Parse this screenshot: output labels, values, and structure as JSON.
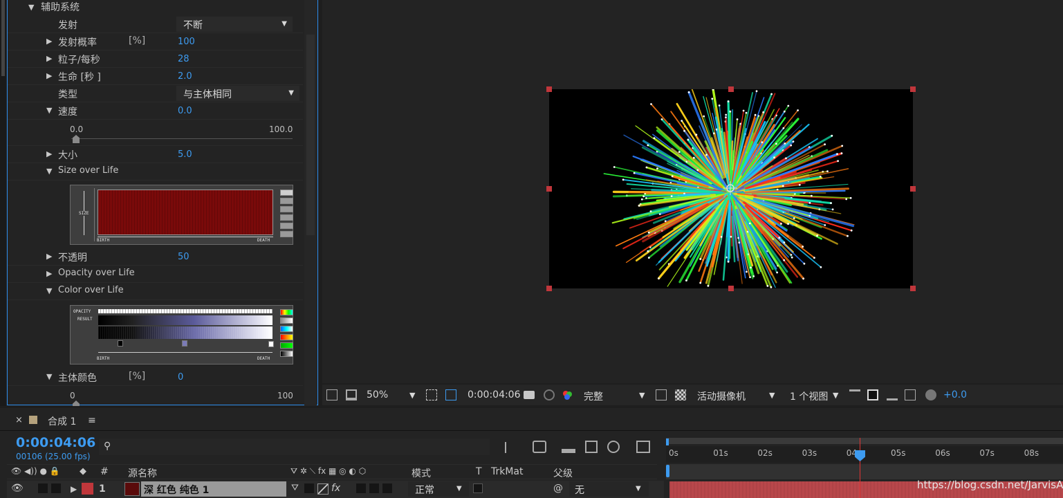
{
  "effects": {
    "section": "辅助系统",
    "rows": {
      "emit_label": "发射",
      "emit_value": "不断",
      "prob_label": "发射概率",
      "prob_unit": "[%]",
      "prob_value": "100",
      "pps_label": "粒子/每秒",
      "pps_value": "28",
      "life_label": "生命 [秒 ]",
      "life_value": "2.0",
      "type_label": "类型",
      "type_value": "与主体相同",
      "speed_label": "速度",
      "speed_value": "0.0",
      "speed_min": "0.0",
      "speed_max": "100.0",
      "size_label": "大小",
      "size_value": "5.0",
      "sol_label": "Size over Life",
      "opacity_label": "不透明",
      "opacity_value": "50",
      "ool_label": "Opacity over Life",
      "col_label": "Color over Life",
      "main_color_label": "主体颜色",
      "main_color_unit": "[%]",
      "main_color_value": "0",
      "main_color_min": "0",
      "main_color_max": "100"
    },
    "size_graph": {
      "axis": "SIZE",
      "start": "BIRTH",
      "end": "DEATH",
      "fill_color": "#7a0a0a"
    },
    "color_graph": {
      "opacity": "OPACITY",
      "result": "RESULT",
      "start": "BIRTH",
      "end": "DEATH"
    }
  },
  "viewer_toolbar": {
    "zoom": "50%",
    "timecode": "0:00:04:06",
    "resolution": "完整",
    "camera": "活动摄像机",
    "views": "1 个视图",
    "exposure": "+0.0"
  },
  "timeline": {
    "comp_tab": "合成 1",
    "current_time": "0:00:04:06",
    "frame_info": "00106 (25.00 fps)",
    "columns": {
      "num": "#",
      "source": "源名称",
      "mode": "模式",
      "t": "T",
      "trkmat": "TrkMat",
      "parent": "父级"
    },
    "layer": {
      "index": "1",
      "name": "深 红色 纯色 1",
      "mode": "正常",
      "parent": "无",
      "label_color": "#c0373b",
      "swatch_color": "#5a0b0b"
    },
    "ruler": [
      "0s",
      "01s",
      "02s",
      "03s",
      "04s",
      "05s",
      "06s",
      "07s",
      "08s"
    ],
    "accent": "#3d9bf0"
  },
  "watermark": "https://blog.csdn.net/JarvisAI"
}
